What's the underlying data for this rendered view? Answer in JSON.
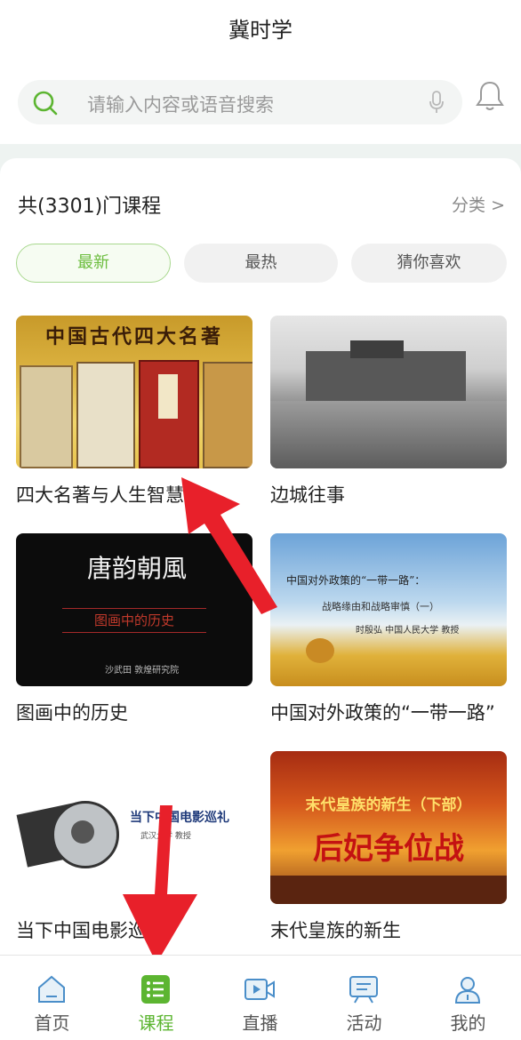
{
  "app": {
    "title": "冀时学"
  },
  "search": {
    "placeholder": "请输入内容或语音搜索"
  },
  "summary": {
    "count_text": "共(3301)门课程",
    "category_label": "分类 >"
  },
  "filter_tabs": [
    {
      "label": "最新",
      "active": true
    },
    {
      "label": "最热",
      "active": false
    },
    {
      "label": "猜你喜欢",
      "active": false
    }
  ],
  "courses": [
    {
      "title": "四大名著与人生智慧",
      "thumb_text": "中国古代四大名著"
    },
    {
      "title": "边城往事"
    },
    {
      "title": "图画中的历史",
      "thumb_text": "图画中的历史",
      "thumb_caption": "唐韵朝風",
      "thumb_footer": "沙武田 敦煌研究院"
    },
    {
      "title": "中国对外政策的“一带一路”",
      "thumb_text": "中国对外政策的“一带一路”：",
      "thumb_sub": "战略缘由和战略审慎（一）",
      "thumb_author": "时殷弘  中国人民大学  教授"
    },
    {
      "title": "当下中国电影巡礼",
      "thumb_text": "当下中国电影巡礼",
      "thumb_sub": "武汉大学 教授"
    },
    {
      "title": "末代皇族的新生",
      "thumb_text": "末代皇族的新生（下部）",
      "thumb_sub": "后妃争位战"
    }
  ],
  "tabbar": [
    {
      "label": "首页",
      "icon": "home-icon",
      "active": false
    },
    {
      "label": "课程",
      "icon": "course-list-icon",
      "active": true
    },
    {
      "label": "直播",
      "icon": "live-video-icon",
      "active": false
    },
    {
      "label": "活动",
      "icon": "activity-icon",
      "active": false
    },
    {
      "label": "我的",
      "icon": "profile-icon",
      "active": false
    }
  ],
  "colors": {
    "accent": "#5cb531",
    "arrow": "#e8202a"
  }
}
